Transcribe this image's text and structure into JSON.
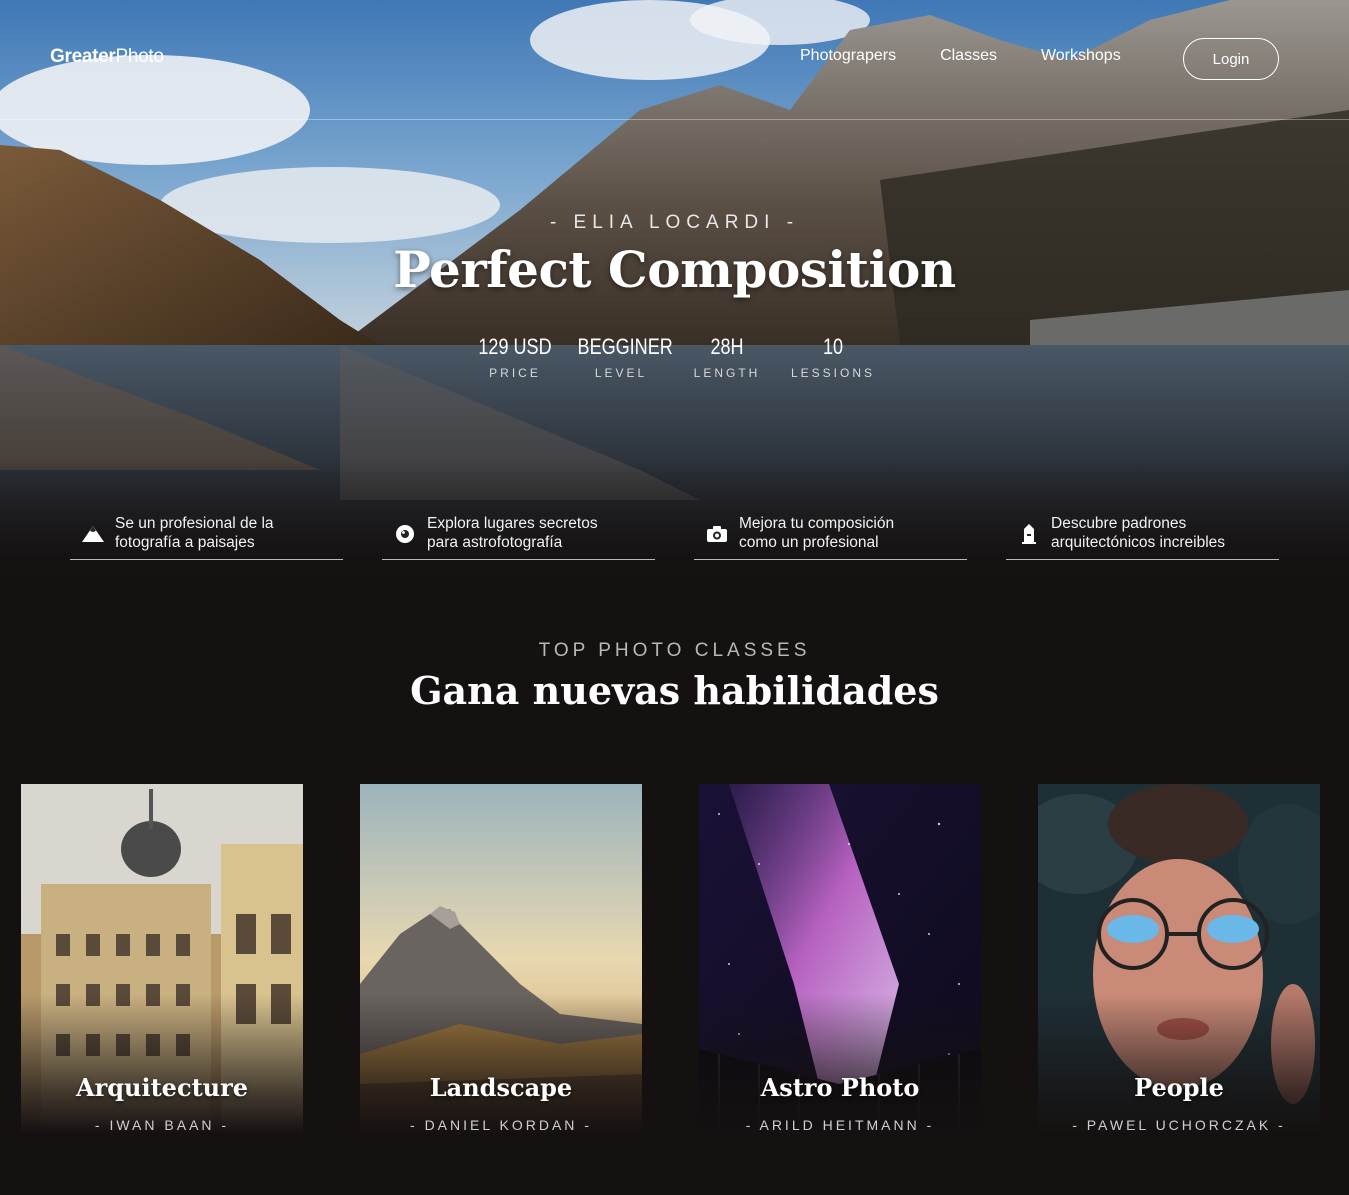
{
  "nav": {
    "logo_bold": "Greater",
    "logo_light": "Photo",
    "links": [
      "Photograpers",
      "Classes",
      "Workshops"
    ],
    "login": "Login"
  },
  "hero": {
    "author": "- ELIA LOCARDI -",
    "title": "Perfect Composition",
    "stats": [
      {
        "value": "129 USD",
        "label": "PRICE"
      },
      {
        "value": "BEGGINER",
        "label": "LEVEL"
      },
      {
        "value": "28H",
        "label": "LENGTH"
      },
      {
        "value": "10",
        "label": "LESSIONS"
      }
    ],
    "features": [
      {
        "icon": "mountain-icon",
        "line1": "Se un profesional de la",
        "line2": "fotografía a paisajes"
      },
      {
        "icon": "lens-icon",
        "line1": "Explora lugares secretos",
        "line2": "para astrofotografía"
      },
      {
        "icon": "camera-icon",
        "line1": "Mejora tu composición",
        "line2": "como un profesional"
      },
      {
        "icon": "building-icon",
        "line1": "Descubre padrones",
        "line2": "arquitectónicos increibles"
      }
    ]
  },
  "classes": {
    "kicker": "TOP PHOTO CLASSES",
    "title": "Gana nuevas habilidades",
    "cards": [
      {
        "name": "Arquitecture",
        "by": "- IWAN BAAN -"
      },
      {
        "name": "Landscape",
        "by": "- DANIEL KORDAN -"
      },
      {
        "name": "Astro Photo",
        "by": "- ARILD HEITMANN -"
      },
      {
        "name": "People",
        "by": "- PAWEL UCHORCZAK -"
      }
    ]
  },
  "colors": {
    "background": "#151111",
    "text": "#ffffff",
    "muted": "#b8b8b8"
  }
}
